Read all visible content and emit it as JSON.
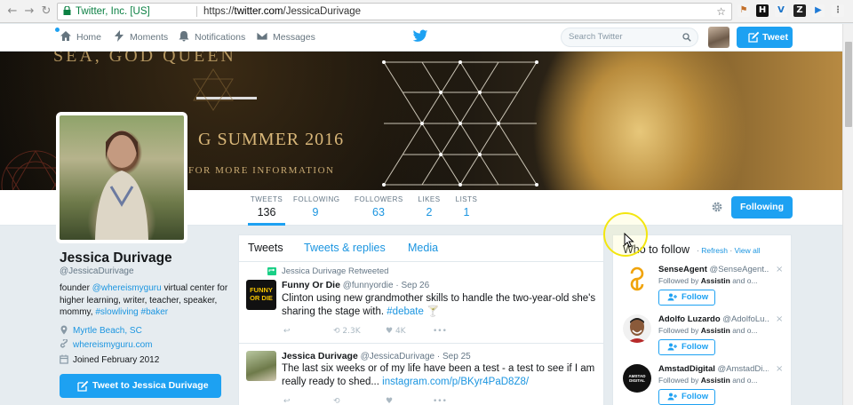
{
  "browser": {
    "secure_label": "Twitter, Inc. [US]",
    "url_prefix": "https://",
    "url_host": "twitter.com",
    "url_path": "/JessicaDurivage"
  },
  "topnav": {
    "items": [
      {
        "label": "Home",
        "icon": "home-icon"
      },
      {
        "label": "Moments",
        "icon": "moments-icon"
      },
      {
        "label": "Notifications",
        "icon": "bell-icon"
      },
      {
        "label": "Messages",
        "icon": "envelope-icon"
      }
    ],
    "search_placeholder": "Search Twitter",
    "tweet_button": "Tweet"
  },
  "banner": {
    "line_top": "SEA, GOD QUEEN",
    "line_main": "G SUMMER 2016",
    "line_sub": "FOR MORE INFORMATION"
  },
  "stats": [
    {
      "label": "TWEETS",
      "value": "136"
    },
    {
      "label": "FOLLOWING",
      "value": "9"
    },
    {
      "label": "FOLLOWERS",
      "value": "63"
    },
    {
      "label": "LIKES",
      "value": "2"
    },
    {
      "label": "LISTS",
      "value": "1"
    }
  ],
  "following_button": "Following",
  "profile": {
    "name": "Jessica Durivage",
    "handle": "@JessicaDurivage",
    "bio_parts": {
      "pre": "founder ",
      "mention": "@whereismyguru",
      "mid": " virtual center for higher learning, writer, teacher, speaker, mommy, ",
      "tag1": "#slowliving",
      "tag2": "#baker"
    },
    "location": "Myrtle Beach, SC",
    "website": "whereismyguru.com",
    "joined": "Joined February 2012",
    "tweet_to_button": "Tweet to Jessica Durivage"
  },
  "timeline": {
    "tabs": [
      "Tweets",
      "Tweets & replies",
      "Media"
    ],
    "tweets": [
      {
        "retweet_line": "Jessica Durivage Retweeted",
        "name": "Funny Or Die",
        "handle": "@funnyordie",
        "date": "Sep 26",
        "text": "Clinton using new grandmother skills to handle the two-year-old she's sharing the stage with.",
        "hashtag": "#debate",
        "retweets": "2.3K",
        "likes": "4K"
      },
      {
        "name": "Jessica Durivage",
        "handle": "@JessicaDurivage",
        "date": "Sep 25",
        "text": "The last six weeks or of my life have been a test - a test to see if I am really ready to shed...",
        "link": "instagram.com/p/BKyr4PaD8Z8/"
      }
    ]
  },
  "who_to_follow": {
    "title": "Who to follow",
    "refresh": "Refresh",
    "view_all": "View all",
    "suggestions": [
      {
        "name": "SenseAgent",
        "handle": "@SenseAgent...",
        "followed_by": "Followed by",
        "by_name": "Assistin",
        "by_more": "and o...",
        "follow": "Follow"
      },
      {
        "name": "Adolfo Luzardo",
        "handle": "@AdolfoLu...",
        "followed_by": "Followed by",
        "by_name": "Assistin",
        "by_more": "and o...",
        "follow": "Follow"
      },
      {
        "name": "AmstadDigital",
        "handle": "@AmstadDi...",
        "followed_by": "Followed by",
        "by_name": "Assistin",
        "by_more": "and o...",
        "follow": "Follow"
      }
    ]
  },
  "tweet_card_logo": "FUNNY OR DIE",
  "amstad_logo": "AMSTAD DIGITAL",
  "colors": {
    "accent": "#1da1f2",
    "link": "#1b95e0",
    "banner_gold": "#d9b779"
  }
}
